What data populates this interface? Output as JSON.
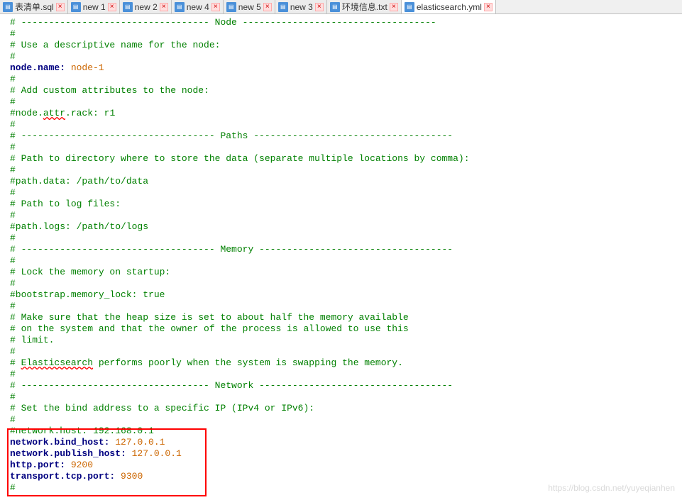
{
  "tabs": [
    {
      "label": "表清单.sql",
      "active": false
    },
    {
      "label": "new 1",
      "active": false
    },
    {
      "label": "new 2",
      "active": false
    },
    {
      "label": "new 4",
      "active": false
    },
    {
      "label": "new 5",
      "active": false
    },
    {
      "label": "new 3",
      "active": false
    },
    {
      "label": "环境信息.txt",
      "active": false
    },
    {
      "label": "elasticsearch.yml",
      "active": true
    }
  ],
  "code": {
    "l1a": "# ---------------------------------- Node -----------------------------------",
    "l2": "#",
    "l3": "# Use a descriptive name for the node:",
    "l4": "#",
    "l5k": "node.name:",
    "l5v": " node-1",
    "l6": "#",
    "l7": "# Add custom attributes to the node:",
    "l8": "#",
    "l9a": "#node.",
    "l9b": "attr",
    "l9c": ".rack: r1",
    "l10": "#",
    "l11": "# ----------------------------------- Paths ------------------------------------",
    "l12": "#",
    "l13": "# Path to directory where to store the data (separate multiple locations by comma):",
    "l14": "#",
    "l15": "#path.data: /path/to/data",
    "l16": "#",
    "l17": "# Path to log files:",
    "l18": "#",
    "l19": "#path.logs: /path/to/logs",
    "l20": "#",
    "l21": "# ----------------------------------- Memory -----------------------------------",
    "l22": "#",
    "l23": "# Lock the memory on startup:",
    "l24": "#",
    "l25": "#bootstrap.memory_lock: true",
    "l26": "#",
    "l27": "# Make sure that the heap size is set to about half the memory available",
    "l28": "# on the system and that the owner of the process is allowed to use this",
    "l29": "# limit.",
    "l30": "#",
    "l31a": "# ",
    "l31b": "Elasticsearch",
    "l31c": " performs poorly when the system is swapping the memory.",
    "l32": "#",
    "l33": "# ---------------------------------- Network -----------------------------------",
    "l34": "#",
    "l35": "# Set the bind address to a specific IP (IPv4 or IPv6):",
    "l36": "#",
    "l37": "#network.host: 192.168.0.1",
    "l38k": "network.bind_host:",
    "l38v": " 127.0.0.1",
    "l39k": "network.publish_host:",
    "l39v": " 127.0.0.1",
    "l40k": "http.port:",
    "l40v": " 9200",
    "l41k": "transport.tcp.port:",
    "l41v": " 9300",
    "l42": "#"
  },
  "watermark": "https://blog.csdn.net/yuyeqianhen"
}
